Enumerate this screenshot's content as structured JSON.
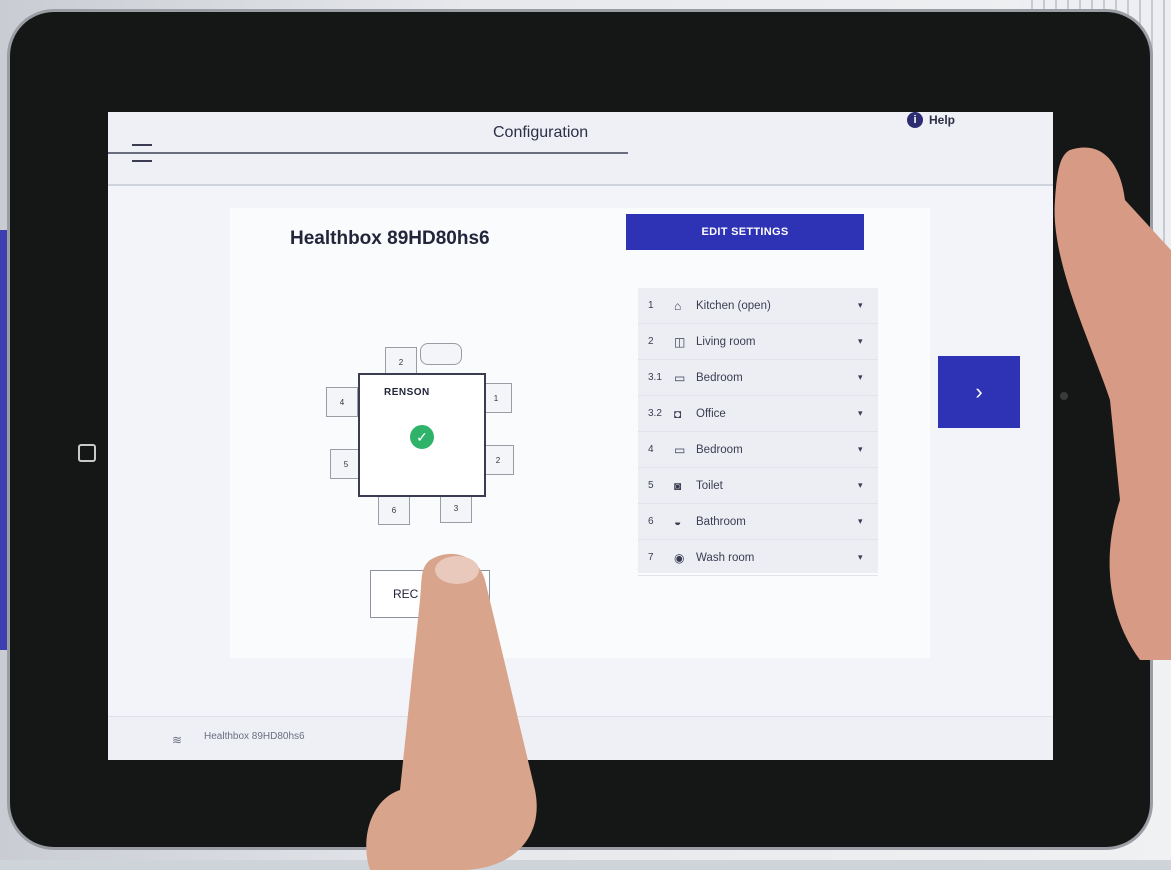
{
  "header": {
    "title": "Configuration",
    "help_label": "Help"
  },
  "device": {
    "name": "Healthbox 89HD80hs6",
    "edit_label": "EDIT SETTINGS",
    "brand": "RENSON",
    "reconfigure_label": "REC",
    "valves": [
      "2",
      "4",
      "1",
      "5",
      "2",
      "6",
      "3"
    ]
  },
  "rooms": [
    {
      "num": "1",
      "icon": "kitchen-icon",
      "label": "Kitchen (open)"
    },
    {
      "num": "2",
      "icon": "sofa-icon",
      "label": "Living room"
    },
    {
      "num": "3.1",
      "icon": "bed-icon",
      "label": "Bedroom"
    },
    {
      "num": "3.2",
      "icon": "office-icon",
      "label": "Office"
    },
    {
      "num": "4",
      "icon": "bed-icon",
      "label": "Bedroom"
    },
    {
      "num": "5",
      "icon": "toilet-icon",
      "label": "Toilet"
    },
    {
      "num": "6",
      "icon": "bath-icon",
      "label": "Bathroom"
    },
    {
      "num": "7",
      "icon": "washer-icon",
      "label": "Wash room"
    }
  ],
  "footer": {
    "connection": "Healthbox 89HD80hs6"
  },
  "colors": {
    "accent": "#2e32b5",
    "success": "#2fb36b"
  }
}
